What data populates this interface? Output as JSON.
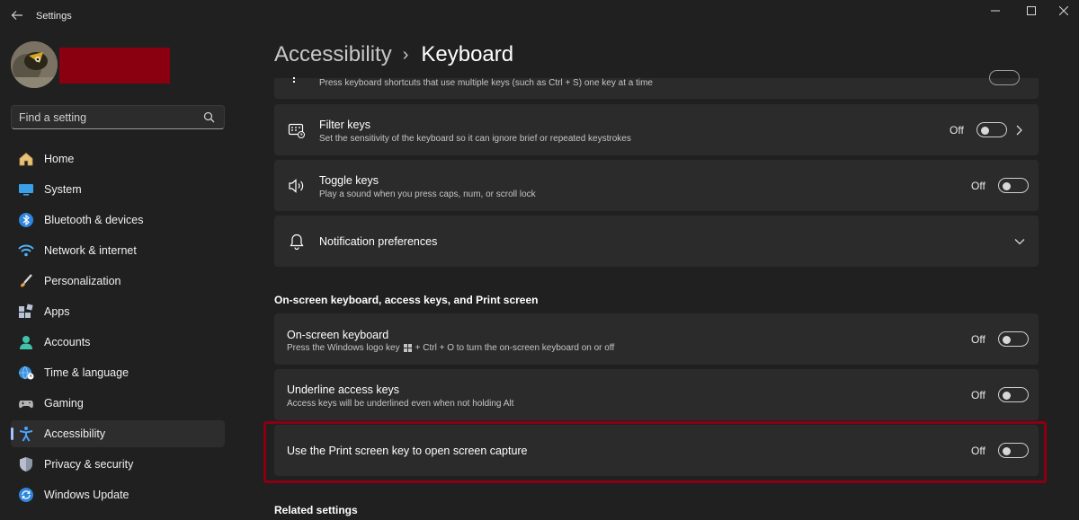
{
  "window": {
    "title": "Settings"
  },
  "user": {
    "name_redacted": true
  },
  "search": {
    "placeholder": "Find a setting"
  },
  "sidebar": {
    "items": [
      {
        "label": "Home",
        "icon": "home-icon"
      },
      {
        "label": "System",
        "icon": "system-icon"
      },
      {
        "label": "Bluetooth & devices",
        "icon": "bluetooth-icon"
      },
      {
        "label": "Network & internet",
        "icon": "wifi-icon"
      },
      {
        "label": "Personalization",
        "icon": "brush-icon"
      },
      {
        "label": "Apps",
        "icon": "apps-icon"
      },
      {
        "label": "Accounts",
        "icon": "accounts-icon"
      },
      {
        "label": "Time & language",
        "icon": "globe-clock-icon"
      },
      {
        "label": "Gaming",
        "icon": "gamepad-icon"
      },
      {
        "label": "Accessibility",
        "icon": "accessibility-icon",
        "active": true
      },
      {
        "label": "Privacy & security",
        "icon": "shield-icon"
      },
      {
        "label": "Windows Update",
        "icon": "update-icon"
      }
    ]
  },
  "breadcrumb": {
    "parent": "Accessibility",
    "separator": "›",
    "current": "Keyboard"
  },
  "main": {
    "sticky_keys": {
      "description": "Press keyboard shortcuts that use multiple keys (such as Ctrl + S) one key at a time"
    },
    "filter_keys": {
      "title": "Filter keys",
      "description": "Set the sensitivity of the keyboard so it can ignore brief or repeated keystrokes",
      "state": "Off"
    },
    "toggle_keys": {
      "title": "Toggle keys",
      "description": "Play a sound when you press caps, num, or scroll lock",
      "state": "Off"
    },
    "notification_prefs": {
      "title": "Notification preferences"
    },
    "section_onscreen": "On-screen keyboard, access keys, and Print screen",
    "onscreen_keyboard": {
      "title": "On-screen keyboard",
      "description_pre": "Press the Windows logo key",
      "description_post": "+ Ctrl + O to turn the on-screen keyboard on or off",
      "state": "Off"
    },
    "underline_keys": {
      "title": "Underline access keys",
      "description": "Access keys will be underlined even when not holding Alt",
      "state": "Off"
    },
    "print_screen": {
      "title": "Use the Print screen key to open screen capture",
      "state": "Off"
    },
    "section_related": "Related settings"
  },
  "colors": {
    "accent": "#a0c4ff",
    "highlight": "#8b0011",
    "background": "#202020",
    "card": "#2b2b2b"
  }
}
